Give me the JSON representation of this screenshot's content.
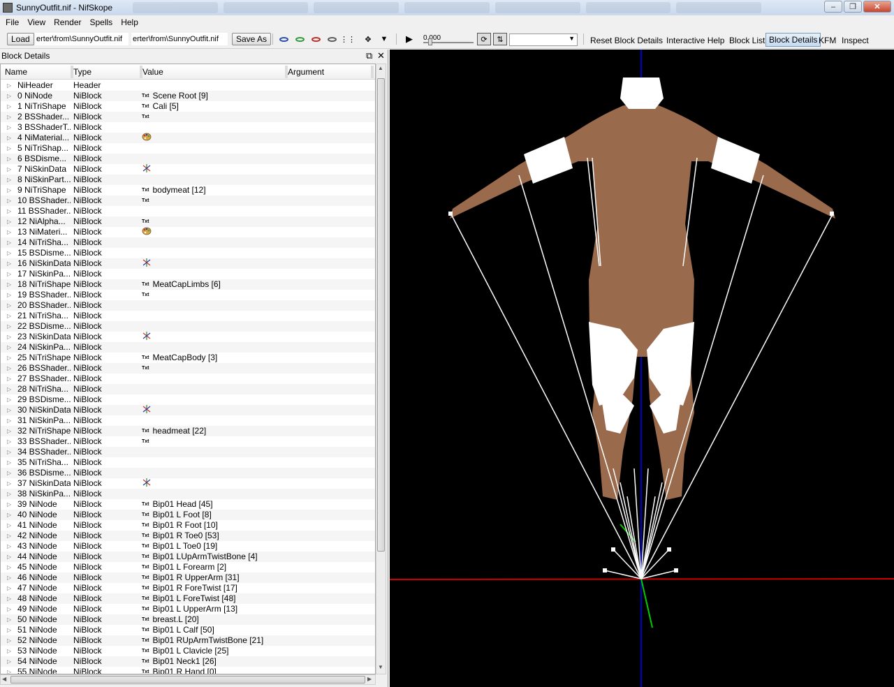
{
  "window": {
    "title": "SunnyOutfit.nif - NifSkope",
    "minimize": "–",
    "maximize": "❐",
    "close": "✕"
  },
  "menu": [
    "File",
    "View",
    "Render",
    "Spells",
    "Help"
  ],
  "toolbar": {
    "load_label": "Load",
    "load_path": "erter\\from\\SunnyOutfit.nif",
    "save_path": "erter\\from\\SunnyOutfit.nif",
    "save_as_label": "Save As",
    "time_value": "0.000",
    "reset_block_details": "Reset Block Details",
    "interactive_help": "Interactive Help",
    "block_list": "Block List",
    "block_details": "Block Details",
    "kfm": "KFM",
    "inspect": "Inspect"
  },
  "dock": {
    "title": "Block Details",
    "float_icon": "⧉",
    "close_icon": "✕"
  },
  "columns": [
    "Name",
    "Type",
    "Value",
    "Argument"
  ],
  "rows": [
    {
      "name": "NiHeader",
      "type": "Header",
      "icon": "",
      "value": ""
    },
    {
      "name": "0 NiNode",
      "type": "NiBlock",
      "icon": "txt",
      "value": "Scene Root [9]"
    },
    {
      "name": "1 NiTriShape",
      "type": "NiBlock",
      "icon": "txt",
      "value": "Cali [5]"
    },
    {
      "name": "2 BSShader...",
      "type": "NiBlock",
      "icon": "txt",
      "value": ""
    },
    {
      "name": "3 BSShaderT...",
      "type": "NiBlock",
      "icon": "",
      "value": ""
    },
    {
      "name": "4 NiMaterial...",
      "type": "NiBlock",
      "icon": "palette",
      "value": ""
    },
    {
      "name": "5 NiTriShap...",
      "type": "NiBlock",
      "icon": "",
      "value": ""
    },
    {
      "name": "6 BSDisme...",
      "type": "NiBlock",
      "icon": "",
      "value": ""
    },
    {
      "name": "7 NiSkinData",
      "type": "NiBlock",
      "icon": "axes",
      "value": ""
    },
    {
      "name": "8 NiSkinPart...",
      "type": "NiBlock",
      "icon": "",
      "value": ""
    },
    {
      "name": "9 NiTriShape",
      "type": "NiBlock",
      "icon": "txt",
      "value": "bodymeat [12]"
    },
    {
      "name": "10 BSShader...",
      "type": "NiBlock",
      "icon": "txt",
      "value": ""
    },
    {
      "name": "11 BSShader...",
      "type": "NiBlock",
      "icon": "",
      "value": ""
    },
    {
      "name": "12 NiAlpha...",
      "type": "NiBlock",
      "icon": "txt",
      "value": ""
    },
    {
      "name": "13 NiMateri...",
      "type": "NiBlock",
      "icon": "palette",
      "value": ""
    },
    {
      "name": "14 NiTriSha...",
      "type": "NiBlock",
      "icon": "",
      "value": ""
    },
    {
      "name": "15 BSDisme...",
      "type": "NiBlock",
      "icon": "",
      "value": ""
    },
    {
      "name": "16 NiSkinData",
      "type": "NiBlock",
      "icon": "axes",
      "value": ""
    },
    {
      "name": "17 NiSkinPa...",
      "type": "NiBlock",
      "icon": "",
      "value": ""
    },
    {
      "name": "18 NiTriShape",
      "type": "NiBlock",
      "icon": "txt",
      "value": "MeatCapLimbs [6]"
    },
    {
      "name": "19 BSShader...",
      "type": "NiBlock",
      "icon": "txt",
      "value": ""
    },
    {
      "name": "20 BSShader...",
      "type": "NiBlock",
      "icon": "",
      "value": ""
    },
    {
      "name": "21 NiTriSha...",
      "type": "NiBlock",
      "icon": "",
      "value": ""
    },
    {
      "name": "22 BSDisme...",
      "type": "NiBlock",
      "icon": "",
      "value": ""
    },
    {
      "name": "23 NiSkinData",
      "type": "NiBlock",
      "icon": "axes",
      "value": ""
    },
    {
      "name": "24 NiSkinPa...",
      "type": "NiBlock",
      "icon": "",
      "value": ""
    },
    {
      "name": "25 NiTriShape",
      "type": "NiBlock",
      "icon": "txt",
      "value": "MeatCapBody [3]"
    },
    {
      "name": "26 BSShader...",
      "type": "NiBlock",
      "icon": "txt",
      "value": ""
    },
    {
      "name": "27 BSShader...",
      "type": "NiBlock",
      "icon": "",
      "value": ""
    },
    {
      "name": "28 NiTriSha...",
      "type": "NiBlock",
      "icon": "",
      "value": ""
    },
    {
      "name": "29 BSDisme...",
      "type": "NiBlock",
      "icon": "",
      "value": ""
    },
    {
      "name": "30 NiSkinData",
      "type": "NiBlock",
      "icon": "axes",
      "value": ""
    },
    {
      "name": "31 NiSkinPa...",
      "type": "NiBlock",
      "icon": "",
      "value": ""
    },
    {
      "name": "32 NiTriShape",
      "type": "NiBlock",
      "icon": "txt",
      "value": "headmeat [22]"
    },
    {
      "name": "33 BSShader...",
      "type": "NiBlock",
      "icon": "txt",
      "value": ""
    },
    {
      "name": "34 BSShader...",
      "type": "NiBlock",
      "icon": "",
      "value": ""
    },
    {
      "name": "35 NiTriSha...",
      "type": "NiBlock",
      "icon": "",
      "value": ""
    },
    {
      "name": "36 BSDisme...",
      "type": "NiBlock",
      "icon": "",
      "value": ""
    },
    {
      "name": "37 NiSkinData",
      "type": "NiBlock",
      "icon": "axes",
      "value": ""
    },
    {
      "name": "38 NiSkinPa...",
      "type": "NiBlock",
      "icon": "",
      "value": ""
    },
    {
      "name": "39 NiNode",
      "type": "NiBlock",
      "icon": "txt",
      "value": "Bip01 Head [45]"
    },
    {
      "name": "40 NiNode",
      "type": "NiBlock",
      "icon": "txt",
      "value": "Bip01 L Foot [8]"
    },
    {
      "name": "41 NiNode",
      "type": "NiBlock",
      "icon": "txt",
      "value": "Bip01 R Foot [10]"
    },
    {
      "name": "42 NiNode",
      "type": "NiBlock",
      "icon": "txt",
      "value": "Bip01 R Toe0 [53]"
    },
    {
      "name": "43 NiNode",
      "type": "NiBlock",
      "icon": "txt",
      "value": "Bip01 L Toe0 [19]"
    },
    {
      "name": "44 NiNode",
      "type": "NiBlock",
      "icon": "txt",
      "value": "Bip01 LUpArmTwistBone [4]"
    },
    {
      "name": "45 NiNode",
      "type": "NiBlock",
      "icon": "txt",
      "value": "Bip01 L Forearm [2]"
    },
    {
      "name": "46 NiNode",
      "type": "NiBlock",
      "icon": "txt",
      "value": "Bip01 R UpperArm [31]"
    },
    {
      "name": "47 NiNode",
      "type": "NiBlock",
      "icon": "txt",
      "value": "Bip01 R ForeTwist [17]"
    },
    {
      "name": "48 NiNode",
      "type": "NiBlock",
      "icon": "txt",
      "value": "Bip01 L ForeTwist [48]"
    },
    {
      "name": "49 NiNode",
      "type": "NiBlock",
      "icon": "txt",
      "value": "Bip01 L UpperArm [13]"
    },
    {
      "name": "50 NiNode",
      "type": "NiBlock",
      "icon": "txt",
      "value": "breast.L [20]"
    },
    {
      "name": "51 NiNode",
      "type": "NiBlock",
      "icon": "txt",
      "value": "Bip01 L Calf [50]"
    },
    {
      "name": "52 NiNode",
      "type": "NiBlock",
      "icon": "txt",
      "value": "Bip01 RUpArmTwistBone [21]"
    },
    {
      "name": "53 NiNode",
      "type": "NiBlock",
      "icon": "txt",
      "value": "Bip01 L Clavicle [25]"
    },
    {
      "name": "54 NiNode",
      "type": "NiBlock",
      "icon": "txt",
      "value": "Bip01 Neck1 [26]"
    },
    {
      "name": "55 NiNode",
      "type": "NiBlock",
      "icon": "txt",
      "value": "Bip01 R Hand [0]"
    }
  ],
  "txt_icon_label": "Txt",
  "colors": {
    "viewport_bg": "#000000",
    "skin": "#9a6a4c",
    "cloth": "#ffffff",
    "axis_x": "#cc0000",
    "axis_y": "#00cc00",
    "axis_z": "#0000cc",
    "bone": "#ffffff"
  }
}
